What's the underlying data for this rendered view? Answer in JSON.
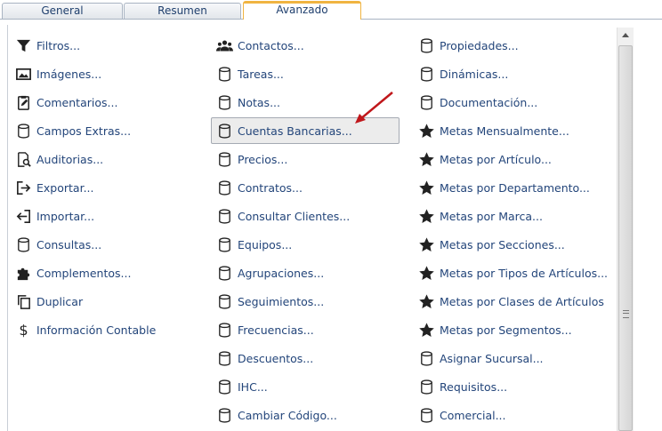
{
  "tabs": [
    {
      "label": "General"
    },
    {
      "label": "Resumen"
    },
    {
      "label": "Avanzado"
    }
  ],
  "columns": [
    [
      {
        "label": "Filtros...",
        "icon": "filter-icon"
      },
      {
        "label": "Imágenes...",
        "icon": "image-icon"
      },
      {
        "label": "Comentarios...",
        "icon": "clipboard-edit-icon"
      },
      {
        "label": "Campos Extras...",
        "icon": "database-icon"
      },
      {
        "label": "Auditorias...",
        "icon": "audit-search-icon"
      },
      {
        "label": "Exportar...",
        "icon": "export-icon"
      },
      {
        "label": "Importar...",
        "icon": "import-icon"
      },
      {
        "label": "Consultas...",
        "icon": "database-icon"
      },
      {
        "label": "Complementos...",
        "icon": "puzzle-icon"
      },
      {
        "label": "Duplicar",
        "icon": "copy-icon"
      },
      {
        "label": "Información Contable",
        "icon": "dollar-icon"
      }
    ],
    [
      {
        "label": "Contactos...",
        "icon": "people-icon"
      },
      {
        "label": "Tareas...",
        "icon": "database-icon"
      },
      {
        "label": "Notas...",
        "icon": "database-icon"
      },
      {
        "label": "Cuentas Bancarias...",
        "icon": "database-icon",
        "selected": true
      },
      {
        "label": "Precios...",
        "icon": "database-icon"
      },
      {
        "label": "Contratos...",
        "icon": "database-icon"
      },
      {
        "label": "Consultar Clientes...",
        "icon": "database-icon"
      },
      {
        "label": "Equipos...",
        "icon": "database-icon"
      },
      {
        "label": "Agrupaciones...",
        "icon": "database-icon"
      },
      {
        "label": "Seguimientos...",
        "icon": "database-icon"
      },
      {
        "label": "Frecuencias...",
        "icon": "database-icon"
      },
      {
        "label": "Descuentos...",
        "icon": "database-icon"
      },
      {
        "label": "IHC...",
        "icon": "database-icon"
      },
      {
        "label": "Cambiar Código...",
        "icon": "database-icon"
      }
    ],
    [
      {
        "label": "Propiedades...",
        "icon": "database-icon"
      },
      {
        "label": "Dinámicas...",
        "icon": "database-icon"
      },
      {
        "label": "Documentación...",
        "icon": "database-icon"
      },
      {
        "label": "Metas Mensualmente...",
        "icon": "star-icon"
      },
      {
        "label": "Metas por Artículo...",
        "icon": "star-icon"
      },
      {
        "label": "Metas por Departamento...",
        "icon": "star-icon"
      },
      {
        "label": "Metas por Marca...",
        "icon": "star-icon"
      },
      {
        "label": "Metas por Secciones...",
        "icon": "star-icon"
      },
      {
        "label": "Metas por Tipos de Artículos...",
        "icon": "star-icon"
      },
      {
        "label": "Metas por Clases de Artículos",
        "icon": "star-icon"
      },
      {
        "label": "Metas por Segmentos...",
        "icon": "star-icon"
      },
      {
        "label": "Asignar Sucursal...",
        "icon": "database-icon"
      },
      {
        "label": "Requisitos...",
        "icon": "database-icon"
      },
      {
        "label": "Comercial...",
        "icon": "database-icon"
      }
    ]
  ],
  "colors": {
    "link": "#23457a",
    "tab_active": "#f0b441",
    "arrow": "#c0171b"
  }
}
